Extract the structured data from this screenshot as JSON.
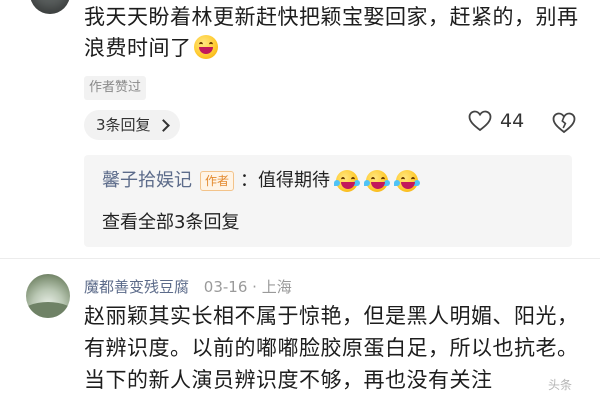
{
  "top_comment": {
    "text": "我天天盼着林更新赶快把颖宝娶回家，赶紧的，别再浪费时间了",
    "emoji": "laughing-emoji",
    "author_liked_label": "作者赞过",
    "replies_label": "3条回复",
    "like_count": "44"
  },
  "reply_box": {
    "user": "馨子拾娱记",
    "author_tag": "作者",
    "separator": "：",
    "text": "值得期待",
    "emojis": [
      "tears-of-joy-emoji",
      "tears-of-joy-emoji",
      "tears-of-joy-emoji"
    ],
    "view_all_label": "查看全部3条回复"
  },
  "second_comment": {
    "user": "魔都善变残豆腐",
    "date": "03-16 · 上海",
    "text": "赵丽颖其实长相不属于惊艳，但是黑人明媚、阳光，有辨识度。以前的嘟嘟脸胶原蛋白足，所以也抗老。当下的新人演员辨识度不够，再也没有关注"
  },
  "watermark": "头条"
}
